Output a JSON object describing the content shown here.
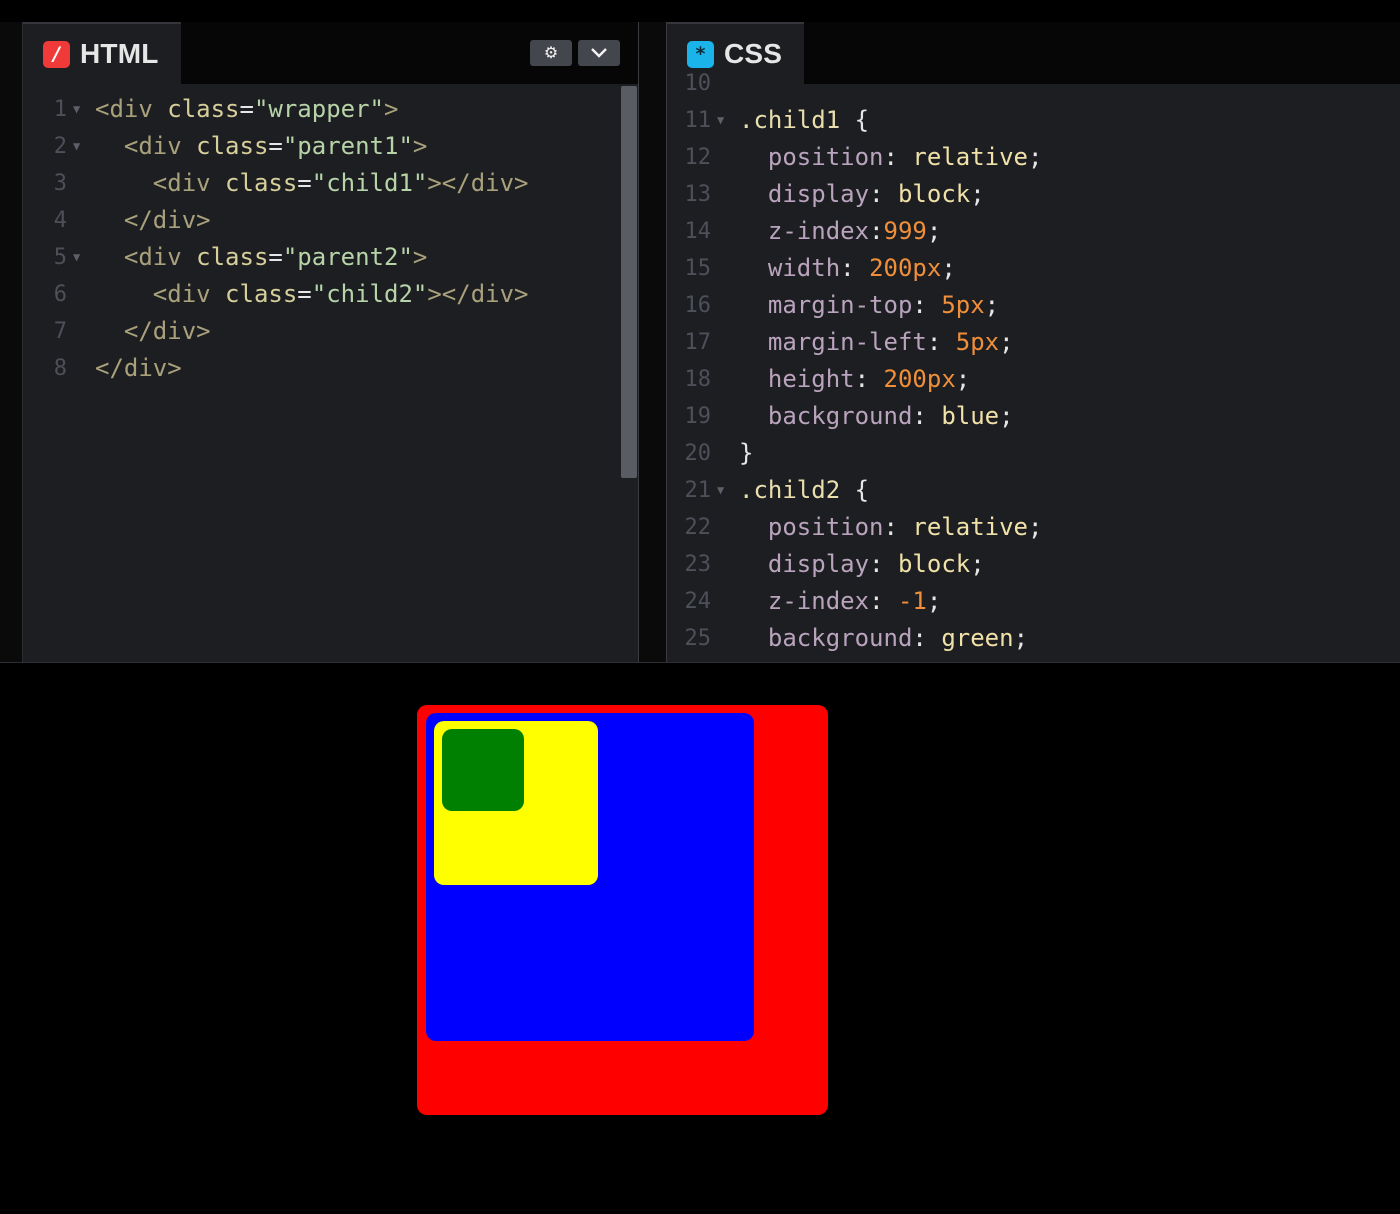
{
  "html_panel": {
    "title": "HTML",
    "icon": "html-slash-icon",
    "icon_glyph": "/",
    "settings_glyph": "⚙",
    "collapse_glyph": "⌄",
    "lines": [
      {
        "n": "1",
        "fold": true,
        "indent": "",
        "segs": [
          [
            "tag",
            "<div "
          ],
          [
            "attr",
            "class"
          ],
          [
            "punc",
            "="
          ],
          [
            "str",
            "\"wrapper\""
          ],
          [
            "tag",
            ">"
          ]
        ]
      },
      {
        "n": "2",
        "fold": true,
        "indent": "  ",
        "segs": [
          [
            "tag",
            "<div "
          ],
          [
            "attr",
            "class"
          ],
          [
            "punc",
            "="
          ],
          [
            "str",
            "\"parent1\""
          ],
          [
            "tag",
            ">"
          ]
        ]
      },
      {
        "n": "3",
        "fold": false,
        "indent": "    ",
        "segs": [
          [
            "tag",
            "<div "
          ],
          [
            "attr",
            "class"
          ],
          [
            "punc",
            "="
          ],
          [
            "str",
            "\"child1\""
          ],
          [
            "tag",
            "></div>"
          ]
        ]
      },
      {
        "n": "4",
        "fold": false,
        "indent": "  ",
        "segs": [
          [
            "tag",
            "</div>"
          ]
        ]
      },
      {
        "n": "5",
        "fold": true,
        "indent": "  ",
        "segs": [
          [
            "tag",
            "<div "
          ],
          [
            "attr",
            "class"
          ],
          [
            "punc",
            "="
          ],
          [
            "str",
            "\"parent2\""
          ],
          [
            "tag",
            ">"
          ]
        ]
      },
      {
        "n": "6",
        "fold": false,
        "indent": "    ",
        "segs": [
          [
            "tag",
            "<div "
          ],
          [
            "attr",
            "class"
          ],
          [
            "punc",
            "="
          ],
          [
            "str",
            "\"child2\""
          ],
          [
            "tag",
            "></div>"
          ]
        ]
      },
      {
        "n": "7",
        "fold": false,
        "indent": "  ",
        "segs": [
          [
            "tag",
            "</div>"
          ]
        ]
      },
      {
        "n": "8",
        "fold": false,
        "indent": "",
        "segs": [
          [
            "tag",
            "</div>"
          ]
        ]
      }
    ]
  },
  "css_panel": {
    "title": "CSS",
    "icon": "css-asterisk-icon",
    "icon_glyph": "*",
    "lines": [
      {
        "n": "10",
        "fold": false,
        "indent": "",
        "segs": []
      },
      {
        "n": "11",
        "fold": true,
        "indent": "",
        "segs": [
          [
            "sel",
            ".child1 "
          ],
          [
            "punc",
            "{"
          ]
        ]
      },
      {
        "n": "12",
        "fold": false,
        "indent": "  ",
        "segs": [
          [
            "prop",
            "position"
          ],
          [
            "punc",
            ": "
          ],
          [
            "val",
            "relative"
          ],
          [
            "punc",
            ";"
          ]
        ]
      },
      {
        "n": "13",
        "fold": false,
        "indent": "  ",
        "segs": [
          [
            "prop",
            "display"
          ],
          [
            "punc",
            ": "
          ],
          [
            "val",
            "block"
          ],
          [
            "punc",
            ";"
          ]
        ]
      },
      {
        "n": "14",
        "fold": false,
        "indent": "  ",
        "segs": [
          [
            "prop",
            "z-index"
          ],
          [
            "punc",
            ":"
          ],
          [
            "num",
            "999"
          ],
          [
            "punc",
            ";"
          ]
        ]
      },
      {
        "n": "15",
        "fold": false,
        "indent": "  ",
        "segs": [
          [
            "prop",
            "width"
          ],
          [
            "punc",
            ": "
          ],
          [
            "num",
            "200px"
          ],
          [
            "punc",
            ";"
          ]
        ]
      },
      {
        "n": "16",
        "fold": false,
        "indent": "  ",
        "segs": [
          [
            "prop",
            "margin-top"
          ],
          [
            "punc",
            ": "
          ],
          [
            "num",
            "5px"
          ],
          [
            "punc",
            ";"
          ]
        ]
      },
      {
        "n": "17",
        "fold": false,
        "indent": "  ",
        "segs": [
          [
            "prop",
            "margin-left"
          ],
          [
            "punc",
            ": "
          ],
          [
            "num",
            "5px"
          ],
          [
            "punc",
            ";"
          ]
        ]
      },
      {
        "n": "18",
        "fold": false,
        "indent": "  ",
        "segs": [
          [
            "prop",
            "height"
          ],
          [
            "punc",
            ": "
          ],
          [
            "num",
            "200px"
          ],
          [
            "punc",
            ";"
          ]
        ]
      },
      {
        "n": "19",
        "fold": false,
        "indent": "  ",
        "segs": [
          [
            "prop",
            "background"
          ],
          [
            "punc",
            ": "
          ],
          [
            "val",
            "blue"
          ],
          [
            "punc",
            ";"
          ]
        ]
      },
      {
        "n": "20",
        "fold": false,
        "indent": "",
        "segs": [
          [
            "punc",
            "}"
          ]
        ]
      },
      {
        "n": "21",
        "fold": true,
        "indent": "",
        "segs": [
          [
            "sel",
            ".child2 "
          ],
          [
            "punc",
            "{"
          ]
        ]
      },
      {
        "n": "22",
        "fold": false,
        "indent": "  ",
        "segs": [
          [
            "prop",
            "position"
          ],
          [
            "punc",
            ": "
          ],
          [
            "val",
            "relative"
          ],
          [
            "punc",
            ";"
          ]
        ]
      },
      {
        "n": "23",
        "fold": false,
        "indent": "  ",
        "segs": [
          [
            "prop",
            "display"
          ],
          [
            "punc",
            ": "
          ],
          [
            "val",
            "block"
          ],
          [
            "punc",
            ";"
          ]
        ]
      },
      {
        "n": "24",
        "fold": false,
        "indent": "  ",
        "segs": [
          [
            "prop",
            "z-index"
          ],
          [
            "punc",
            ": "
          ],
          [
            "num",
            "-1"
          ],
          [
            "punc",
            ";"
          ]
        ]
      },
      {
        "n": "25",
        "fold": false,
        "indent": "  ",
        "segs": [
          [
            "prop",
            "background"
          ],
          [
            "punc",
            ": "
          ],
          [
            "val",
            "green"
          ],
          [
            "punc",
            ";"
          ]
        ]
      }
    ]
  },
  "preview": {
    "boxes": [
      {
        "name": "wrapper-box-red",
        "color": "#ff0000"
      },
      {
        "name": "child1-box-blue",
        "color": "#0000ff"
      },
      {
        "name": "parent-box-yellow",
        "color": "#ffff00"
      },
      {
        "name": "child2-box-green",
        "color": "#008000"
      }
    ]
  },
  "colors": {
    "editor_bg": "#1d1e22",
    "html_accent": "#f03a3a",
    "css_accent": "#1ab3ea"
  }
}
